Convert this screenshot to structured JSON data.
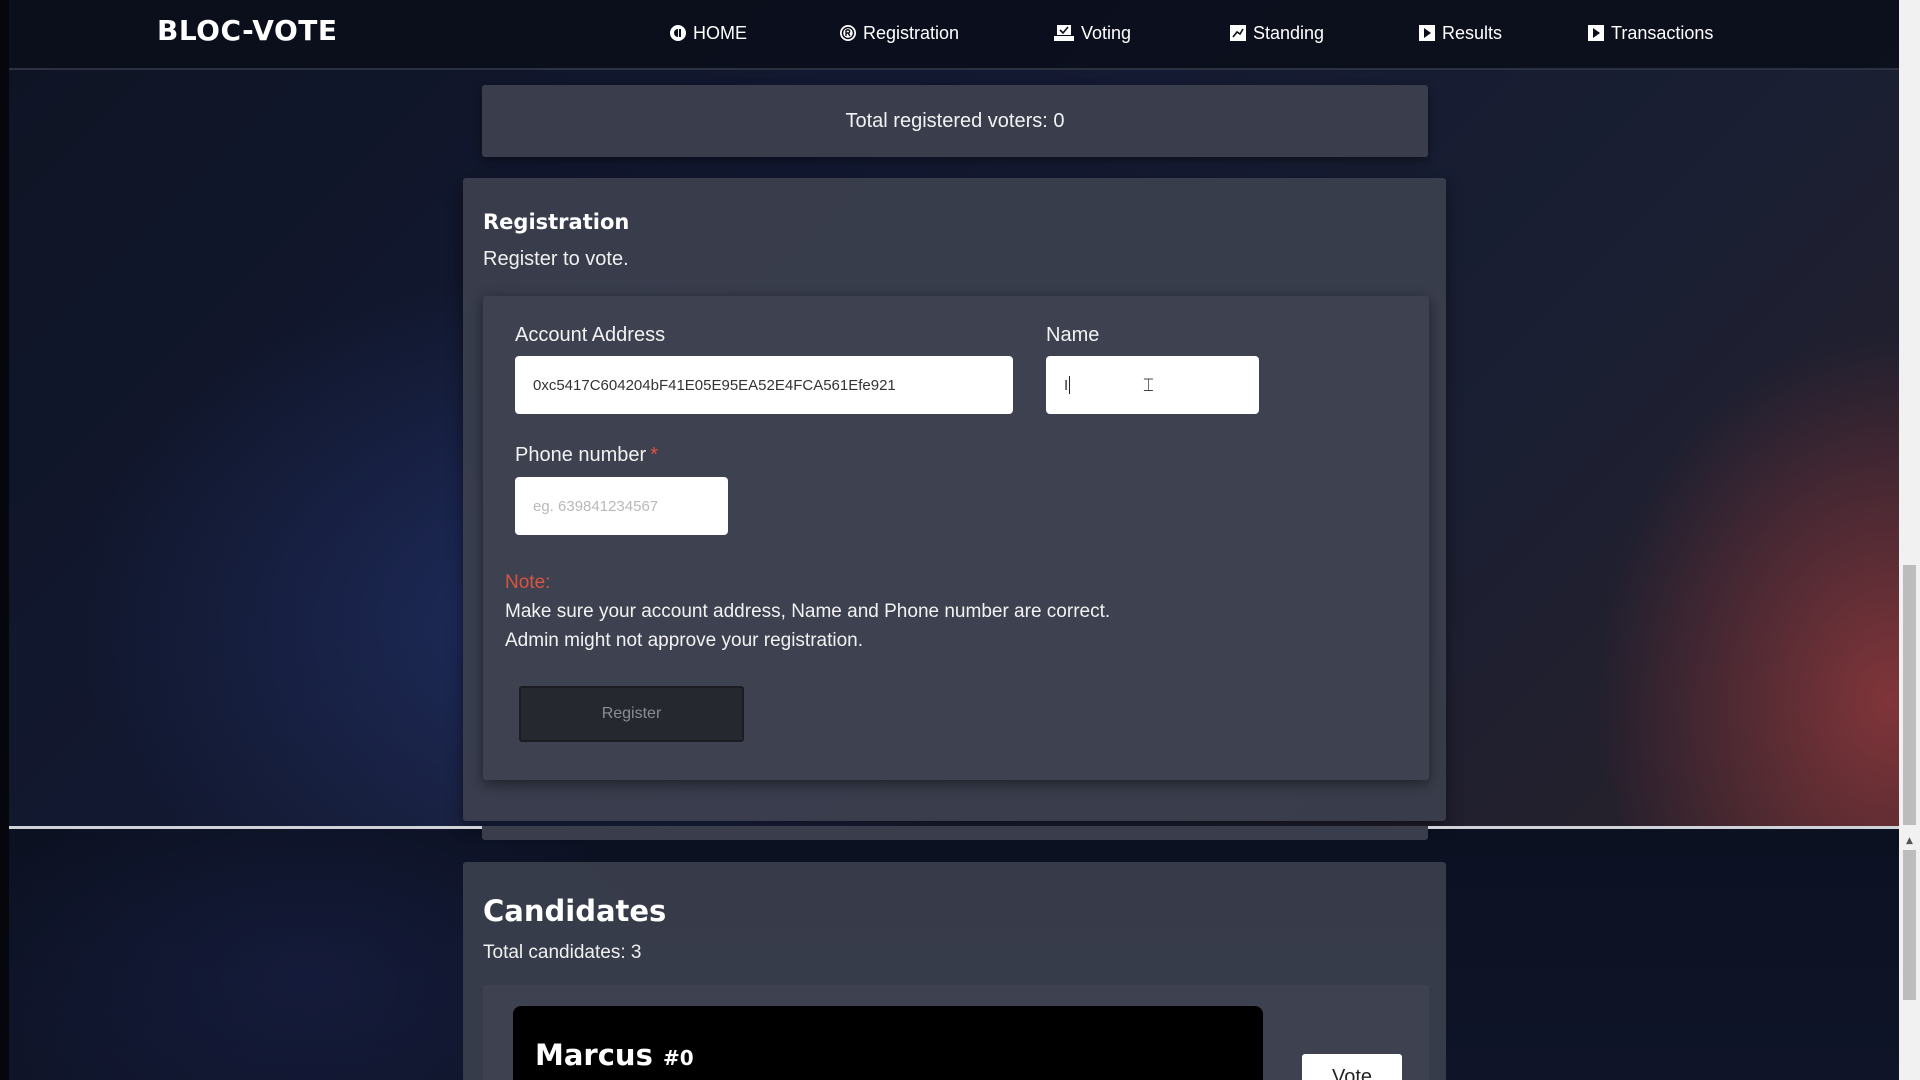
{
  "brand": "BLOC-VOTE",
  "nav": [
    {
      "label": "HOME",
      "icon": "home-icon"
    },
    {
      "label": "Registration",
      "icon": "registration-icon"
    },
    {
      "label": "Voting",
      "icon": "voting-icon"
    },
    {
      "label": "Standing",
      "icon": "standing-icon"
    },
    {
      "label": "Results",
      "icon": "results-icon"
    },
    {
      "label": "Transactions",
      "icon": "transactions-icon"
    }
  ],
  "voters": {
    "text": "Total registered voters: 0"
  },
  "registration": {
    "title": "Registration",
    "subtitle": "Register to vote.",
    "account_label": "Account Address",
    "account_value": "0xc5417C604204bF41E05E95EA52E4FCA561Efe921",
    "name_label": "Name",
    "name_value": "I",
    "phone_label": "Phone number",
    "phone_required": "*",
    "phone_placeholder": "eg. 639841234567",
    "note_label": "Note:",
    "note_line1": "Make sure your account address, Name and Phone number are correct.",
    "note_line2": "Admin might not approve your registration.",
    "register_label": "Register"
  },
  "candidates": {
    "title": "Candidates",
    "total": "Total candidates: 3",
    "list": [
      {
        "name": "Marcus",
        "id": "#0",
        "vote_label": "Vote"
      }
    ]
  },
  "colors": {
    "accent_note": "#d9553f",
    "panel": "#3d4150",
    "nav_bg": "#0a0e1a"
  }
}
